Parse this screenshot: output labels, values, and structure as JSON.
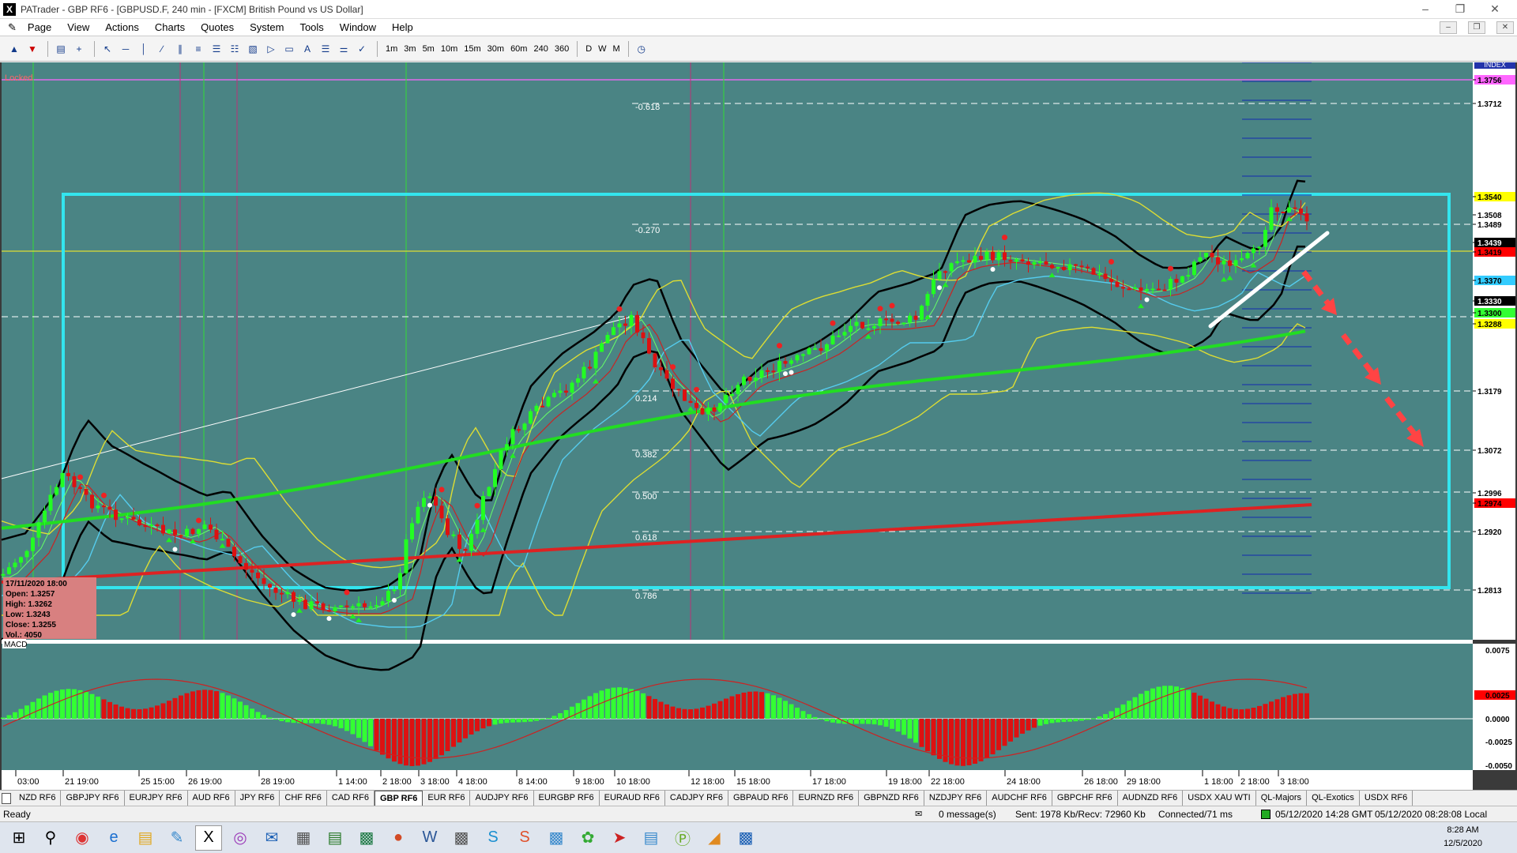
{
  "window": {
    "title": "PATrader - GBP RF6 - [GBPUSD.F, 240 min - [FXCM] British Pound vs US Dollar]",
    "app_icon": "X"
  },
  "menu": [
    "Page",
    "View",
    "Actions",
    "Charts",
    "Quotes",
    "System",
    "Tools",
    "Window",
    "Help"
  ],
  "toolbar": {
    "timeframes": [
      "1m",
      "3m",
      "5m",
      "10m",
      "15m",
      "30m",
      "60m",
      "240",
      "360",
      "D",
      "W",
      "M"
    ]
  },
  "chart": {
    "locked_label": "Locked",
    "index_label": "INDEX",
    "macd_label": "MACD",
    "info_box": {
      "date": "17/11/2020 18:00",
      "open": "Open: 1.3257",
      "high": "High: 1.3262",
      "low": "Low: 1.3243",
      "close": "Close: 1.3255",
      "vol": "Vol.: 4050"
    },
    "fib_labels": [
      "-0.618",
      "-0.270",
      "0.214",
      "0.382",
      "0.500",
      "0.618",
      "0.786"
    ],
    "price_labels": [
      {
        "text": "1.3756",
        "color": "#ff66ff"
      },
      {
        "text": "1.3712",
        "color": "#ffffff"
      },
      {
        "text": "1.3540",
        "color": "#ffff00"
      },
      {
        "text": "1.3508",
        "color": "#ffffff"
      },
      {
        "text": "1.3489",
        "color": "#ffffff"
      },
      {
        "text": "1.3439",
        "color": "#000000"
      },
      {
        "text": "1.3419",
        "color": "#ff0000"
      },
      {
        "text": "1.3370",
        "color": "#33ccff"
      },
      {
        "text": "1.3330",
        "color": "#000000"
      },
      {
        "text": "1.3300",
        "color": "#33ff33"
      },
      {
        "text": "1.3288",
        "color": "#ffff00"
      },
      {
        "text": "1.3179",
        "color": "#ffffff"
      },
      {
        "text": "1.3072",
        "color": "#ffffff"
      },
      {
        "text": "1.2996",
        "color": "#ffffff"
      },
      {
        "text": "1.2974",
        "color": "#ff0000"
      },
      {
        "text": "1.2920",
        "color": "#ffffff"
      },
      {
        "text": "1.2813",
        "color": "#ffffff"
      }
    ],
    "macd_labels": [
      "0.0075",
      "0.0025",
      "0.0000",
      "-0.0025",
      "-0.0050"
    ],
    "date_labels": [
      "03:00",
      "21 19:00",
      "25 15:00",
      "26 19:00",
      "28 19:00",
      "1 14:00",
      "2 18:00",
      "3 18:00",
      "4 18:00",
      "8 14:00",
      "9 18:00",
      "10 18:00",
      "12 18:00",
      "15 18:00",
      "17 18:00",
      "19 18:00",
      "22 18:00",
      "24 18:00",
      "26 18:00",
      "29 18:00",
      "1 18:00",
      "2 18:00",
      "3 18:00"
    ]
  },
  "tabs": [
    "NZD RF6",
    "GBPJPY RF6",
    "EURJPY RF6",
    "AUD RF6",
    "JPY RF6",
    "CHF RF6",
    "CAD RF6",
    "GBP RF6",
    "EUR RF6",
    "AUDJPY RF6",
    "EURGBP RF6",
    "EURAUD RF6",
    "CADJPY RF6",
    "GBPAUD RF6",
    "EURNZD RF6",
    "GBPNZD RF6",
    "NZDJPY RF6",
    "AUDCHF RF6",
    "GBPCHF RF6",
    "AUDNZD RF6",
    "USDX XAU WTI",
    "QL-Majors",
    "QL-Exotics",
    "USDX RF6"
  ],
  "active_tab": "GBP RF6",
  "status": {
    "ready": "Ready",
    "messages": "0 message(s)",
    "traffic": "Sent: 1978 Kb/Recv: 72960 Kb",
    "connection": "Connected/71 ms",
    "time": "05/12/2020 14:28 GMT",
    "local_time": "05/12/2020 08:28:08 Local"
  },
  "taskbar": {
    "time": "8:28 AM",
    "date": "12/5/2020"
  }
}
